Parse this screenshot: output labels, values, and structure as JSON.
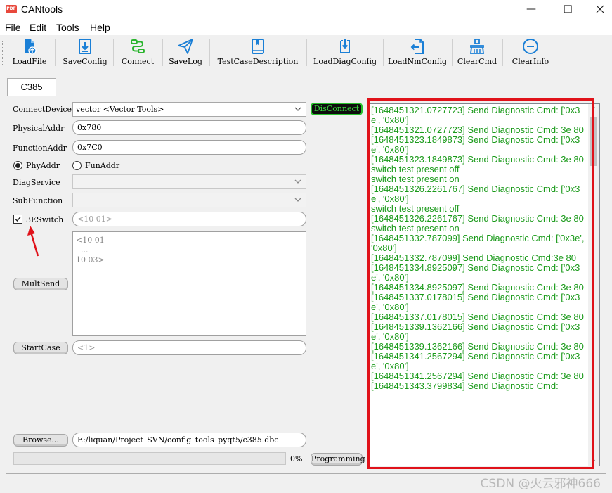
{
  "window": {
    "title": "CANtools",
    "icon_text": "PDF",
    "controls": [
      "minimize-icon",
      "maximize-icon",
      "close-icon"
    ]
  },
  "menu": [
    "File",
    "Edit",
    "Tools",
    "Help"
  ],
  "toolbar": {
    "items": [
      {
        "label": "LoadFile",
        "icon": "file-upload-icon",
        "color": "#1a7fd6"
      },
      {
        "label": "SaveConfig",
        "icon": "download-doc-icon",
        "color": "#1a7fd6"
      },
      {
        "label": "Connect",
        "icon": "connect-icon",
        "color": "#2bb52f"
      },
      {
        "label": "SaveLog",
        "icon": "paper-plane-icon",
        "color": "#1a7fd6"
      },
      {
        "label": "TestCaseDescription",
        "icon": "book-icon",
        "color": "#1a7fd6"
      },
      {
        "label": "LoadDiagConfig",
        "icon": "load-doc-icon",
        "color": "#1a7fd6"
      },
      {
        "label": "LoadNmConfig",
        "icon": "import-doc-icon",
        "color": "#1a7fd6"
      },
      {
        "label": "ClearCmd",
        "icon": "broom-icon",
        "color": "#1a7fd6"
      },
      {
        "label": "ClearInfo",
        "icon": "minus-circle-icon",
        "color": "#1a7fd6"
      }
    ]
  },
  "tab": {
    "label": "C385"
  },
  "form": {
    "connect_device_label": "ConnectDevice",
    "connect_device_value": "vector <Vector Tools>",
    "disconnect_button": "DisConnect",
    "physical_addr_label": "PhysicalAddr",
    "physical_addr_value": "0x780",
    "function_addr_label": "FunctionAddr",
    "function_addr_value": "0x7C0",
    "phy_addr_radio": "PhyAddr",
    "fun_addr_radio": "FunAddr",
    "phy_addr_checked": true,
    "diag_service_label": "DiagService",
    "diag_service_value": "",
    "sub_function_label": "SubFunction",
    "sub_function_value": "",
    "switch_3e_label": "3ESwitch",
    "switch_3e_checked": true,
    "switch_3e_placeholder": "<10 01>",
    "multisend_button": "MultSend",
    "multisend_placeholder": "<10 01\n  ...\n10 03>",
    "startcase_button": "StartCase",
    "startcase_placeholder": "<1>",
    "browse_button": "Browse...",
    "browse_path": "E:/liquan/Project_SVN/config_tools_pyqt5/c385.dbc",
    "progress_value": 0,
    "progress_text": "0%",
    "programming_button": "Programming"
  },
  "log": {
    "color": "#1a9a1a",
    "lines": [
      "[1648451321.0727723] Send Diagnostic Cmd: ['0x3e', '0x80']",
      "[1648451321.0727723] Send Diagnostic Cmd: 3e 80",
      "[1648451323.1849873] Send Diagnostic Cmd: ['0x3e', '0x80']",
      "[1648451323.1849873] Send Diagnostic Cmd: 3e 80",
      "switch test present off",
      "switch test present on",
      "[1648451326.2261767] Send Diagnostic Cmd: ['0x3e', '0x80']",
      "switch test present off",
      "[1648451326.2261767] Send Diagnostic Cmd: 3e 80",
      "switch test present on",
      "[1648451332.787099] Send Diagnostic Cmd: ['0x3e', '0x80']",
      "[1648451332.787099] Send Diagnostic Cmd:3e 80",
      "[1648451334.8925097] Send Diagnostic Cmd: ['0x3e', '0x80']",
      "[1648451334.8925097] Send Diagnostic Cmd: 3e 80",
      "[1648451337.0178015] Send Diagnostic Cmd: ['0x3e', '0x80']",
      "[1648451337.0178015] Send Diagnostic Cmd: 3e 80",
      "[1648451339.1362166] Send Diagnostic Cmd: ['0x3e', '0x80']",
      "[1648451339.1362166] Send Diagnostic Cmd: 3e 80",
      "[1648451341.2567294] Send Diagnostic Cmd: ['0x3e', '0x80']",
      "[1648451341.2567294] Send Diagnostic Cmd: 3e 80",
      "[1648451343.3799834] Send Diagnostic Cmd:"
    ]
  },
  "annotation": {
    "arrow_color": "#e0121a",
    "box_color": "#e0121a"
  },
  "watermark": "CSDN @火云邪神666"
}
